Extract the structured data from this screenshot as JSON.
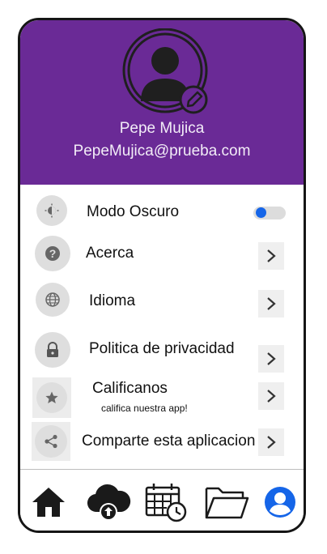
{
  "profile": {
    "name": "Pepe Mujica",
    "email": "PepeMujica@prueba.com"
  },
  "colors": {
    "header_bg": "#6a2a96",
    "accent": "#1565e8"
  },
  "settings": [
    {
      "label": "Modo Oscuro",
      "icon": "dark-mode-icon",
      "control": "toggle",
      "enabled": true
    },
    {
      "label": "Acerca",
      "icon": "help-icon",
      "control": "chevron"
    },
    {
      "label": "Idioma",
      "icon": "globe-icon",
      "control": "chevron"
    },
    {
      "label": "Politica de privacidad",
      "icon": "lock-icon",
      "control": "chevron"
    },
    {
      "label": "Calificanos",
      "sublabel": "califica nuestra app!",
      "icon": "star-icon",
      "control": "chevron"
    },
    {
      "label": "Comparte esta aplicacion",
      "icon": "share-icon",
      "control": "chevron"
    }
  ],
  "nav": [
    {
      "icon": "home-icon",
      "active": false
    },
    {
      "icon": "cloud-upload-icon",
      "active": false
    },
    {
      "icon": "calendar-clock-icon",
      "active": false
    },
    {
      "icon": "folder-icon",
      "active": false
    },
    {
      "icon": "account-icon",
      "active": true
    }
  ]
}
